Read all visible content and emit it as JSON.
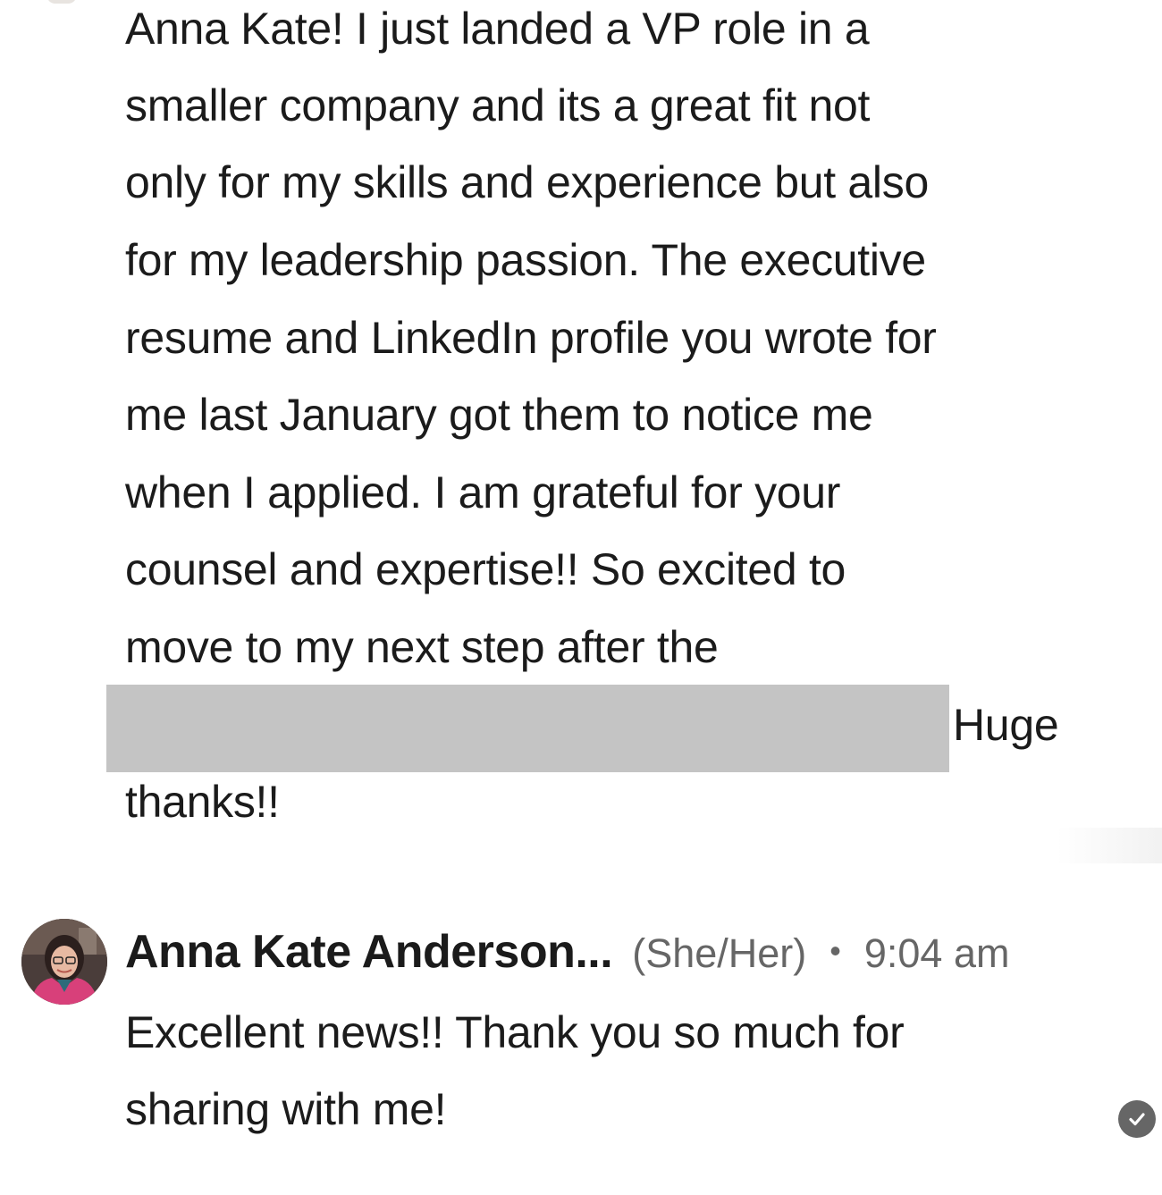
{
  "incoming_message": {
    "lines": [
      "Anna Kate! I just landed a VP role in a",
      "smaller company and its a great fit not",
      "only for my skills and experience but also",
      "for my leadership passion. The executive",
      "resume and LinkedIn profile you wrote for",
      "me last January got them to notice me",
      "when I applied. I am grateful for your",
      "counsel and expertise!! So excited to",
      "move to my next step after the",
      "Huge",
      "thanks!!"
    ]
  },
  "reply": {
    "sender_name": "Anna Kate Anderson...",
    "pronouns": "(She/Her)",
    "separator": "•",
    "timestamp": "9:04 am",
    "lines": [
      "Excellent news!! Thank you so much for",
      "sharing with me!"
    ],
    "avatar_icon": "profile-photo",
    "status_icon": "read-checkmark-icon"
  },
  "colors": {
    "text_primary": "#1b1b1b",
    "text_secondary": "#666666",
    "redaction": "#c4c4c4",
    "background": "#ffffff"
  }
}
